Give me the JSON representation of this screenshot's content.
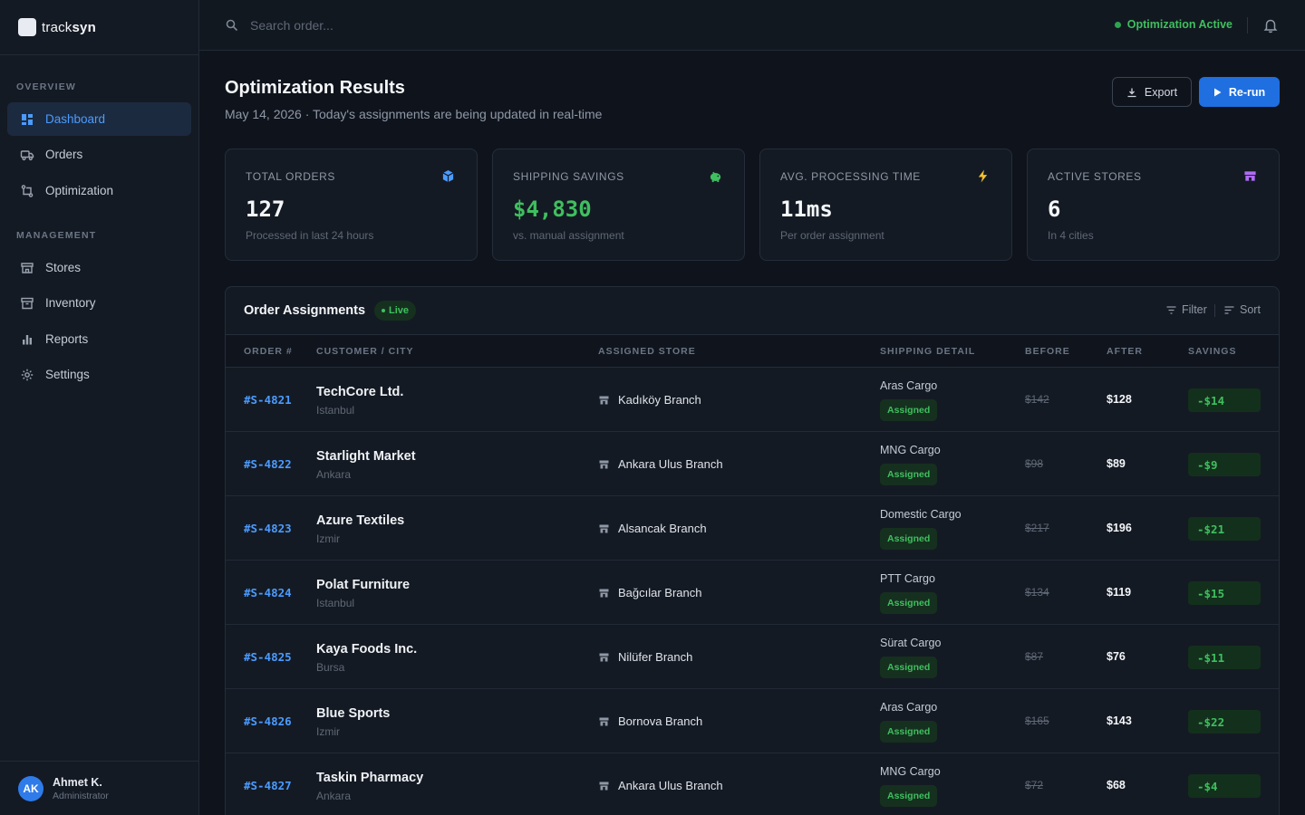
{
  "brand": {
    "name_light": "track",
    "name_bold": "syn"
  },
  "sidebar": {
    "overview_label": "OVERVIEW",
    "management_label": "MANAGEMENT",
    "items": [
      {
        "label": "Dashboard",
        "icon": "dashboard-icon",
        "active": true
      },
      {
        "label": "Orders",
        "icon": "truck-icon"
      },
      {
        "label": "Optimization",
        "icon": "optimization-icon"
      },
      {
        "label": "Stores",
        "icon": "store-icon"
      },
      {
        "label": "Inventory",
        "icon": "archive-icon"
      },
      {
        "label": "Reports",
        "icon": "bar-chart-icon"
      },
      {
        "label": "Settings",
        "icon": "gear-icon"
      }
    ]
  },
  "user": {
    "initials": "AK",
    "name": "Ahmet K.",
    "role": "Administrator"
  },
  "topbar": {
    "search_placeholder": "Search order...",
    "status": "Optimization Active"
  },
  "header": {
    "title": "Optimization Results",
    "subtitle": "May 14, 2026 · Today's assignments are being updated in real-time",
    "export_label": "Export",
    "rerun_label": "Re-run"
  },
  "stats": [
    {
      "label": "TOTAL ORDERS",
      "value": "127",
      "note": "Processed in last 24 hours",
      "icon": "box-icon",
      "color": "#4b9bff"
    },
    {
      "label": "SHIPPING SAVINGS",
      "value": "$4,830",
      "note": "vs. manual assignment",
      "icon": "piggy-bank-icon",
      "color": "#3fbf5f"
    },
    {
      "label": "AVG. PROCESSING TIME",
      "value": "11ms",
      "note": "Per order assignment",
      "icon": "lightning-icon",
      "color": "#f2c230"
    },
    {
      "label": "ACTIVE STORES",
      "value": "6",
      "note": "In 4 cities",
      "icon": "store-icon",
      "color": "#b06cf5"
    }
  ],
  "table": {
    "title": "Order Assignments",
    "live_label": "Live",
    "filter_label": "Filter",
    "sort_label": "Sort",
    "columns": [
      "ORDER #",
      "CUSTOMER / CITY",
      "ASSIGNED STORE",
      "SHIPPING DETAIL",
      "BEFORE",
      "AFTER",
      "SAVINGS"
    ],
    "rows": [
      {
        "order": "#S-4821",
        "customer": "TechCore Ltd.",
        "city": "Istanbul",
        "store": "Kadıköy Branch",
        "carrier": "Aras Cargo",
        "status": "Assigned",
        "before": "$142",
        "after": "$128",
        "savings": "-$14"
      },
      {
        "order": "#S-4822",
        "customer": "Starlight Market",
        "city": "Ankara",
        "store": "Ankara Ulus Branch",
        "carrier": "MNG Cargo",
        "status": "Assigned",
        "before": "$98",
        "after": "$89",
        "savings": "-$9"
      },
      {
        "order": "#S-4823",
        "customer": "Azure Textiles",
        "city": "Izmir",
        "store": "Alsancak Branch",
        "carrier": "Domestic Cargo",
        "status": "Assigned",
        "before": "$217",
        "after": "$196",
        "savings": "-$21"
      },
      {
        "order": "#S-4824",
        "customer": "Polat Furniture",
        "city": "Istanbul",
        "store": "Bağcılar Branch",
        "carrier": "PTT Cargo",
        "status": "Assigned",
        "before": "$134",
        "after": "$119",
        "savings": "-$15"
      },
      {
        "order": "#S-4825",
        "customer": "Kaya Foods Inc.",
        "city": "Bursa",
        "store": "Nilüfer Branch",
        "carrier": "Sürat Cargo",
        "status": "Assigned",
        "before": "$87",
        "after": "$76",
        "savings": "-$11"
      },
      {
        "order": "#S-4826",
        "customer": "Blue Sports",
        "city": "Izmir",
        "store": "Bornova Branch",
        "carrier": "Aras Cargo",
        "status": "Assigned",
        "before": "$165",
        "after": "$143",
        "savings": "-$22"
      },
      {
        "order": "#S-4827",
        "customer": "Taskin Pharmacy",
        "city": "Ankara",
        "store": "Ankara Ulus Branch",
        "carrier": "MNG Cargo",
        "status": "Assigned",
        "before": "$72",
        "after": "$68",
        "savings": "-$4"
      }
    ]
  }
}
